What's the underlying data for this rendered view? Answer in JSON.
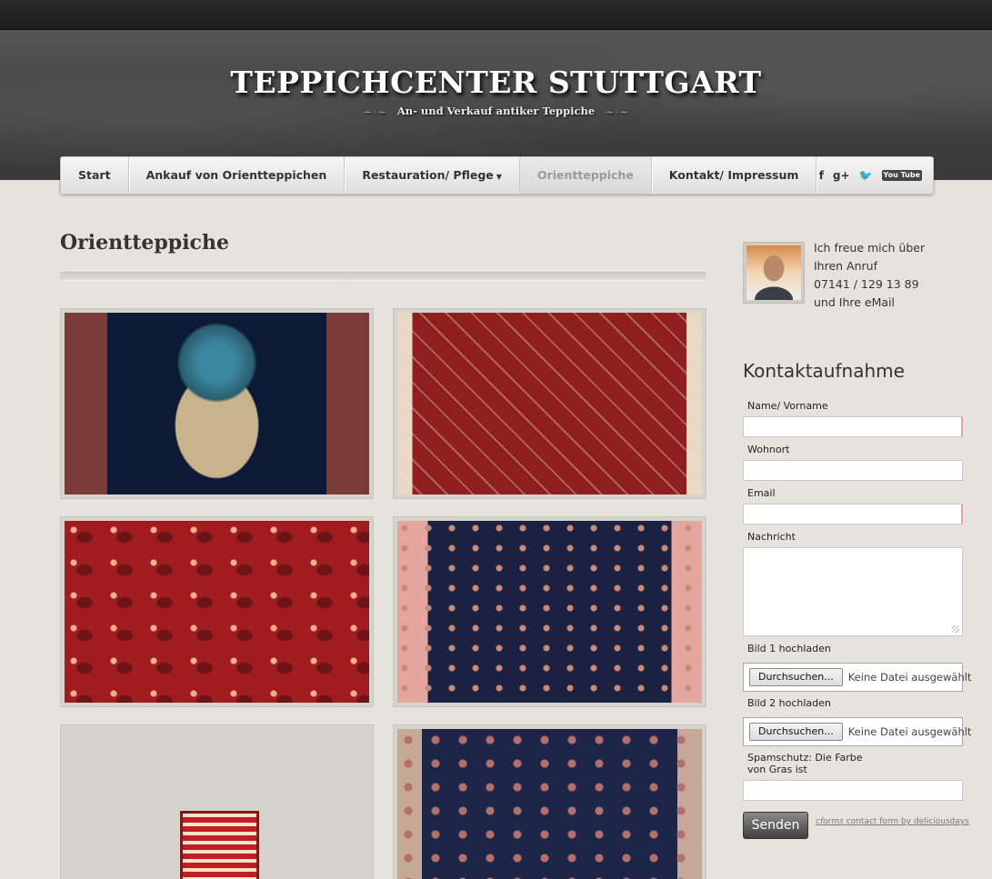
{
  "header": {
    "title": "TEPPICHCENTER STUTTGART",
    "subtitle": "An- und Verkauf antiker Teppiche"
  },
  "nav": {
    "items": [
      {
        "label": "Start"
      },
      {
        "label": "Ankauf von Orientteppichen"
      },
      {
        "label": "Restauration/ Pflege"
      },
      {
        "label": "Orientteppiche"
      },
      {
        "label": "Kontakt/ Impressum"
      }
    ],
    "social": {
      "facebook": "f",
      "googleplus": "g+",
      "youtube": "You Tube"
    }
  },
  "main": {
    "title": "Orientteppiche",
    "gallery": [
      {
        "icon": "carpet-image"
      },
      {
        "icon": "carpet-image"
      },
      {
        "icon": "carpet-image"
      },
      {
        "icon": "carpet-image"
      },
      {
        "icon": "carpet-image"
      },
      {
        "icon": "carpet-image"
      }
    ]
  },
  "sidebar": {
    "call": {
      "line1": "Ich freue mich über",
      "line2": "Ihren Anruf",
      "line3": "07141 / 129 13 89",
      "line4": "und Ihre eMail"
    },
    "form": {
      "heading": "Kontaktaufnahme",
      "name_label": "Name/ Vorname",
      "wohnort_label": "Wohnort",
      "email_label": "Email",
      "nachricht_label": "Nachricht",
      "bild1_label": "Bild 1 hochladen",
      "bild2_label": "Bild 2 hochladen",
      "browse_label": "Durchsuchen...",
      "no_file": "Keine Datei ausgewählt",
      "spam_line1": "Spamschutz: Die Farbe",
      "spam_line2": "von Gras ist",
      "send_label": "Senden",
      "credit_brand": "cforms",
      "credit_text": "contact form by deliciousdays"
    }
  }
}
